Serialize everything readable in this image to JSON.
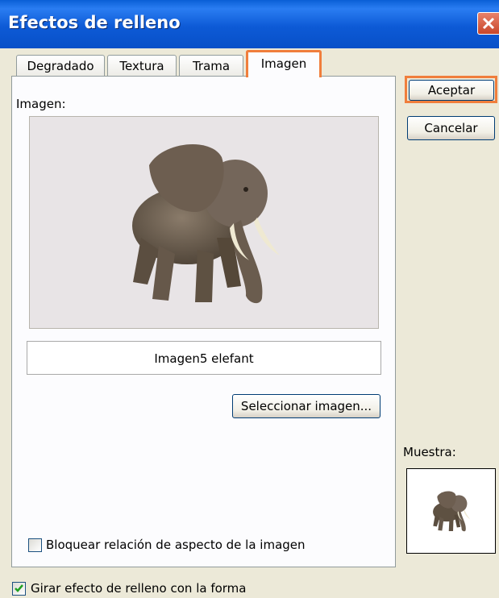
{
  "window": {
    "title": "Efectos de relleno"
  },
  "tabs": [
    {
      "label": "Degradado",
      "active": false
    },
    {
      "label": "Textura",
      "active": false
    },
    {
      "label": "Trama",
      "active": false
    },
    {
      "label": "Imagen",
      "active": true
    }
  ],
  "panel": {
    "image_label": "Imagen:",
    "image_name": "Imagen5 elefant",
    "select_button": "Seleccionar imagen...",
    "lock_aspect": {
      "label": "Bloquear relación de aspecto de la imagen",
      "checked": false
    }
  },
  "buttons": {
    "accept": "Aceptar",
    "cancel": "Cancelar"
  },
  "preview": {
    "label": "Muestra:"
  },
  "rotate_fill": {
    "label": "Girar efecto de relleno con la forma",
    "checked": true
  },
  "colors": {
    "highlight": "#f07e3c",
    "titlebar": "#0a5fd6"
  }
}
